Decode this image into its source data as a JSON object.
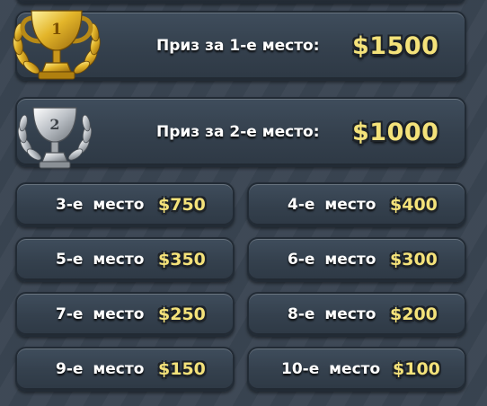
{
  "top_prizes": [
    {
      "label": "Приз за 1-е место:",
      "amount": "$1500",
      "trophy_rank": "1",
      "trophy": "gold-trophy-icon",
      "color": "#e0b325"
    },
    {
      "label": "Приз за 2-е место:",
      "amount": "$1000",
      "trophy_rank": "2",
      "trophy": "silver-trophy-icon",
      "color": "#bfc3c7"
    }
  ],
  "places": [
    {
      "label": "3-е место",
      "amount": "$750"
    },
    {
      "label": "4-е место",
      "amount": "$400"
    },
    {
      "label": "5-е место",
      "amount": "$350"
    },
    {
      "label": "6-е место",
      "amount": "$300"
    },
    {
      "label": "7-е место",
      "amount": "$250"
    },
    {
      "label": "8-е место",
      "amount": "$200"
    },
    {
      "label": "9-е место",
      "amount": "$150"
    },
    {
      "label": "10-е место",
      "amount": "$100"
    }
  ],
  "colors": {
    "amount": "#f4e27a",
    "panel": "#3a4655",
    "background": "#3a4552"
  }
}
